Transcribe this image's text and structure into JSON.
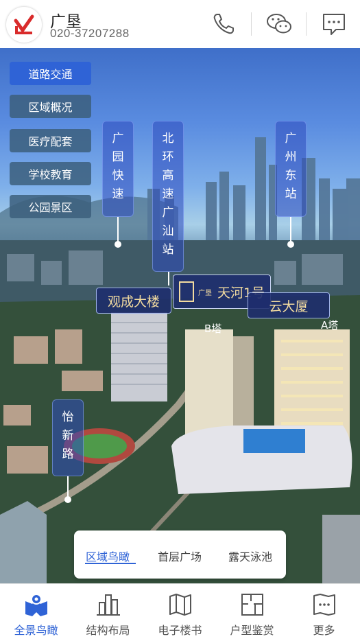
{
  "header": {
    "brand_name": "广垦",
    "phone": "020-37207288",
    "icons": [
      "phone-icon",
      "wechat-icon",
      "message-icon"
    ]
  },
  "categories": [
    {
      "label": "道路交通",
      "active": true
    },
    {
      "label": "区域概况",
      "active": false
    },
    {
      "label": "医疗配套",
      "active": false
    },
    {
      "label": "学校教育",
      "active": false
    },
    {
      "label": "公园景区",
      "active": false
    }
  ],
  "road_labels": [
    {
      "text": "广园快速",
      "chars": [
        "广",
        "园",
        "快",
        "速"
      ]
    },
    {
      "text": "北环高速广汕站",
      "chars": [
        "北",
        "环",
        "高",
        "速",
        "广",
        "汕",
        "站"
      ]
    },
    {
      "text": "广州东站",
      "chars": [
        "广",
        "州",
        "东",
        "站"
      ]
    },
    {
      "text": "怡新路",
      "chars": [
        "怡",
        "新",
        "路"
      ]
    }
  ],
  "building_labels": {
    "guancheng": "观成大楼",
    "tianhe_brand": "天河1号",
    "tianhe_mark": "广垦",
    "yunda": "云大厦",
    "tower_b": "B塔",
    "tower_a": "A塔"
  },
  "view_tabs": [
    {
      "label": "区域鸟瞰",
      "active": true
    },
    {
      "label": "首层广场",
      "active": false
    },
    {
      "label": "露天泳池",
      "active": false
    }
  ],
  "bottom_nav": [
    {
      "label": "全景鸟瞰",
      "icon": "map-pin-icon",
      "active": true
    },
    {
      "label": "结构布局",
      "icon": "bar-structure-icon",
      "active": false
    },
    {
      "label": "电子楼书",
      "icon": "book-map-icon",
      "active": false
    },
    {
      "label": "户型鉴赏",
      "icon": "floorplan-icon",
      "active": false
    },
    {
      "label": "更多",
      "icon": "more-icon",
      "active": false
    }
  ],
  "colors": {
    "accent": "#2f63d6",
    "logo_red": "#d92b2b",
    "label_gold": "#f3dca0"
  }
}
